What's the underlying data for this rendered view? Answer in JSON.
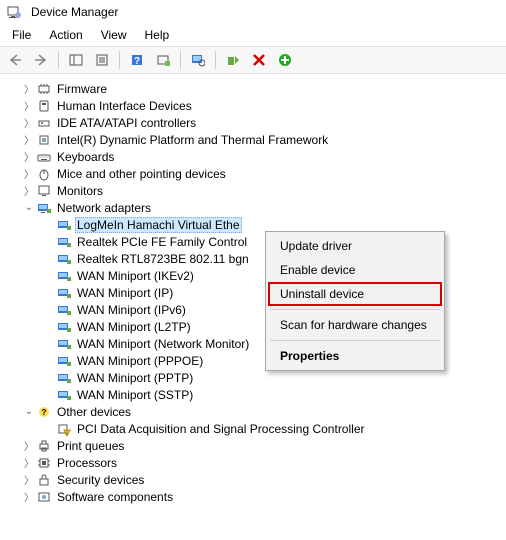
{
  "window": {
    "title": "Device Manager"
  },
  "menu": {
    "file": "File",
    "action": "Action",
    "view": "View",
    "help": "Help"
  },
  "tree": {
    "firmware": "Firmware",
    "hid": "Human Interface Devices",
    "ide": "IDE ATA/ATAPI controllers",
    "intel": "Intel(R) Dynamic Platform and Thermal Framework",
    "keyboards": "Keyboards",
    "mice": "Mice and other pointing devices",
    "monitors": "Monitors",
    "network": "Network adapters",
    "net_items": {
      "hamachi": "LogMeIn Hamachi Virtual Ethe",
      "realtek_fe": "Realtek PCIe FE Family Control",
      "realtek_wifi": "Realtek RTL8723BE 802.11 bgn",
      "wan_ikev2": "WAN Miniport (IKEv2)",
      "wan_ip": "WAN Miniport (IP)",
      "wan_ipv6": "WAN Miniport (IPv6)",
      "wan_l2tp": "WAN Miniport (L2TP)",
      "wan_netmon": "WAN Miniport (Network Monitor)",
      "wan_pppoe": "WAN Miniport (PPPOE)",
      "wan_pptp": "WAN Miniport (PPTP)",
      "wan_sstp": "WAN Miniport (SSTP)"
    },
    "other": "Other devices",
    "other_items": {
      "pci": "PCI Data Acquisition and Signal Processing Controller"
    },
    "printqueues": "Print queues",
    "processors": "Processors",
    "security": "Security devices",
    "software": "Software components"
  },
  "context": {
    "update": "Update driver",
    "enable": "Enable device",
    "uninstall": "Uninstall device",
    "scan": "Scan for hardware changes",
    "properties": "Properties"
  }
}
